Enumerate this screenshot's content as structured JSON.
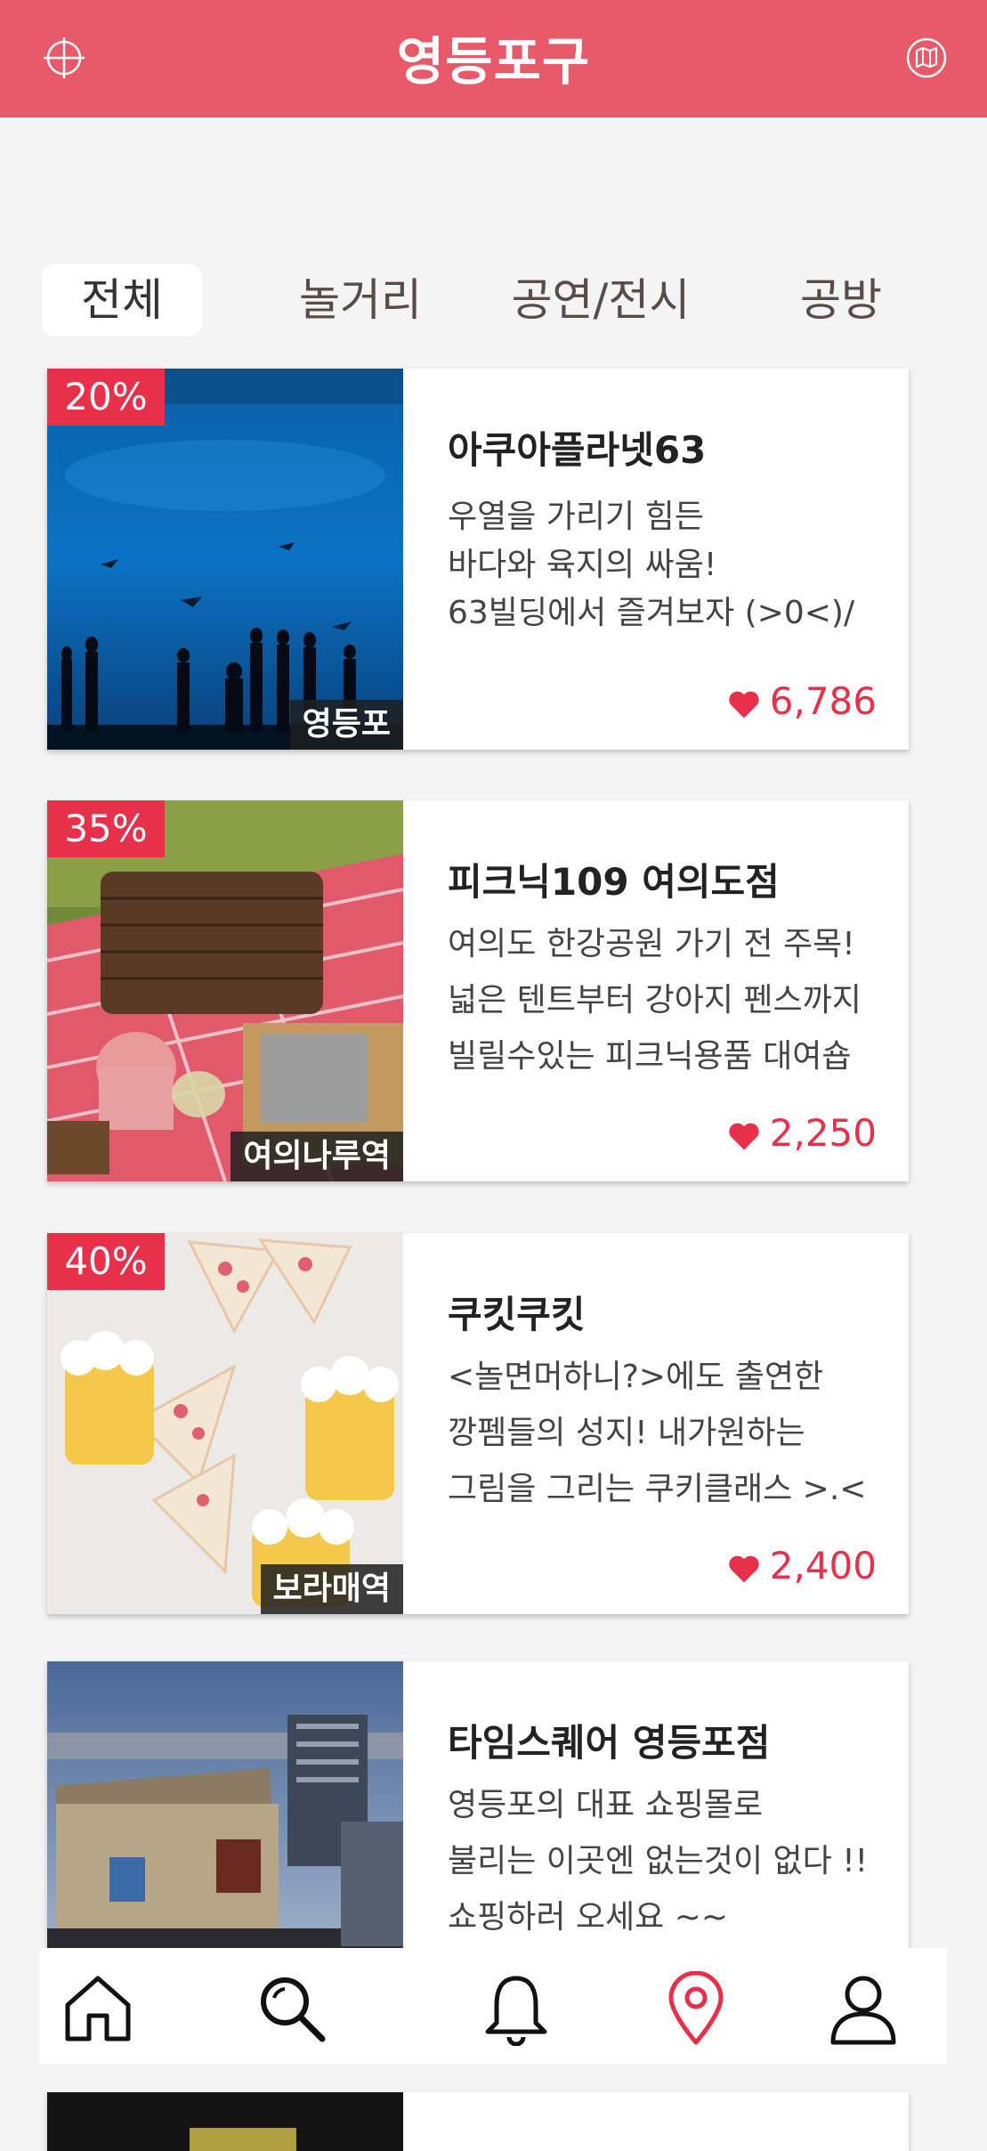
{
  "header": {
    "title": "영등포구",
    "left_icon": "crosshair-icon",
    "right_icon": "map-icon"
  },
  "tabs": [
    {
      "label": "전체",
      "active": true
    },
    {
      "label": "놀거리",
      "active": false
    },
    {
      "label": "공연/전시",
      "active": false
    },
    {
      "label": "공방",
      "active": false
    }
  ],
  "cards": [
    {
      "title": "아쿠아플라넷63",
      "discount": "20%",
      "location": "영등포",
      "description": [
        "우열을 가리기 힘든",
        "바다와 육지의 싸움!",
        "63빌딩에서 즐겨보자 (>0<)/"
      ],
      "likes": "6,786",
      "image": "aquarium-photo"
    },
    {
      "title": "피크닉109 여의도점",
      "discount": "35%",
      "location": "여의나루역",
      "description": [
        "여의도 한강공원 가기 전 주목!",
        "넓은 텐트부터 강아지 펜스까지",
        "빌릴수있는 피크닉용품 대여숍"
      ],
      "likes": "2,250",
      "image": "picnic-photo"
    },
    {
      "title": "쿠킷쿠킷",
      "discount": "40%",
      "location": "보라매역",
      "description": [
        "<놀면머하니?>에도 출연한",
        "깡펨들의 성지!  내가원하는",
        "그림을 그리는 쿠키클래스 >.<"
      ],
      "likes": "2,400",
      "image": "cookie-photo"
    },
    {
      "title": "타임스퀘어 영등포점",
      "description": [
        "영등포의 대표 쇼핑몰로",
        "불리는 이곳엔  없는것이 없다 !!",
        "쇼핑하러 오세요 ~~"
      ],
      "image": "mall-photo"
    }
  ],
  "bottom_nav": [
    {
      "icon": "home-icon"
    },
    {
      "icon": "search-icon"
    },
    {
      "icon": "bell-icon"
    },
    {
      "icon": "location-pin-icon",
      "active": true
    },
    {
      "icon": "user-icon"
    }
  ],
  "colors": {
    "brand": "#e85a6a",
    "discount": "#e8304a",
    "likes": "#e8304a",
    "background": "#f4f4f4"
  }
}
